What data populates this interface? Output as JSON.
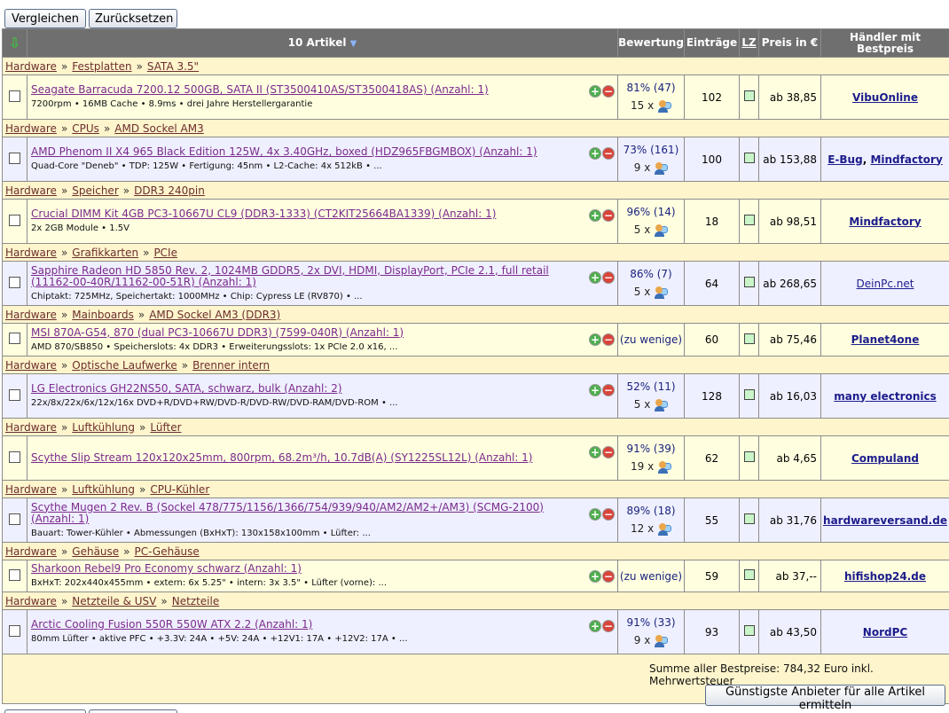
{
  "top_buttons": {
    "compare": "Vergleichen",
    "reset": "Zurücksetzen"
  },
  "header": {
    "sort_icon": "green-down-arrow-icon",
    "articles": "10 Artikel",
    "rating": "Bewertung",
    "entries": "Einträge",
    "lz": "LZ",
    "price": "Preis in €",
    "seller": "Händler mit Bestpreis"
  },
  "sections": [
    {
      "path": [
        "Hardware",
        "Festplatten",
        "SATA 3.5\""
      ],
      "item": {
        "name": "Seagate Barracuda 7200.12 500GB, SATA II (ST3500410AS/ST3500418AS) (Anzahl: 1)",
        "desc": "7200rpm • 16MB Cache • 8.9ms • drei Jahre Herstellergarantie",
        "rating": "81% (47)",
        "reviews": "15 x",
        "entries": "102",
        "price": "ab 38,85",
        "sellers": [
          "VibuOnline"
        ],
        "seller_style": "bold"
      }
    },
    {
      "path": [
        "Hardware",
        "CPUs",
        "AMD Sockel AM3"
      ],
      "item": {
        "name": "AMD Phenom II X4 965 Black Edition 125W, 4x 3.40GHz, boxed (HDZ965FBGMBOX) (Anzahl: 1)",
        "desc": "Quad-Core \"Deneb\" • TDP: 125W • Fertigung: 45nm • L2-Cache: 4x 512kB • ...",
        "rating": "73% (161)",
        "reviews": "9 x",
        "entries": "100",
        "price": "ab 153,88",
        "sellers": [
          "E-Bug",
          "Mindfactory"
        ],
        "seller_style": "bold"
      }
    },
    {
      "path": [
        "Hardware",
        "Speicher",
        "DDR3 240pin"
      ],
      "item": {
        "name": "Crucial DIMM Kit 4GB PC3-10667U CL9 (DDR3-1333) (CT2KIT25664BA1339) (Anzahl: 1)",
        "desc": "2x 2GB Module • 1.5V",
        "rating": "96% (14)",
        "reviews": "5 x",
        "entries": "18",
        "price": "ab 98,51",
        "sellers": [
          "Mindfactory"
        ],
        "seller_style": "bold"
      }
    },
    {
      "path": [
        "Hardware",
        "Grafikkarten",
        "PCIe"
      ],
      "item": {
        "name": "Sapphire Radeon HD 5850 Rev. 2, 1024MB GDDR5, 2x DVI, HDMI, DisplayPort, PCIe 2.1, full retail (11162-00-40R/11162-00-51R) (Anzahl: 1)",
        "desc": "Chiptakt: 725MHz, Speichertakt: 1000MHz • Chip: Cypress LE (RV870) • ...",
        "rating": "86% (7)",
        "reviews": "5 x",
        "entries": "64",
        "price": "ab 268,65",
        "sellers": [
          "DeinPc.net"
        ],
        "seller_style": "plain"
      }
    },
    {
      "path": [
        "Hardware",
        "Mainboards",
        "AMD Sockel AM3 (DDR3)"
      ],
      "item": {
        "name": "MSI 870A-G54, 870 (dual PC3-10667U DDR3) (7599-040R) (Anzahl: 1)",
        "desc": "AMD 870/SB850 • Speicherslots: 4x DDR3 • Erweiterungsslots: 1x PCIe 2.0 x16, ...",
        "rating": "(zu wenige)",
        "reviews": "",
        "entries": "60",
        "price": "ab 75,46",
        "sellers": [
          "Planet4one"
        ],
        "seller_style": "bold"
      }
    },
    {
      "path": [
        "Hardware",
        "Optische Laufwerke",
        "Brenner intern"
      ],
      "item": {
        "name": "LG Electronics GH22NS50, SATA, schwarz, bulk (Anzahl: 2)",
        "desc": "22x/8x/22x/6x/12x/16x DVD+R/DVD+RW/DVD-R/DVD-RW/DVD-RAM/DVD-ROM • ...",
        "rating": "52% (11)",
        "reviews": "5 x",
        "entries": "128",
        "price": "ab 16,03",
        "sellers": [
          "many electronics"
        ],
        "seller_style": "bold"
      }
    },
    {
      "path": [
        "Hardware",
        "Luftkühlung",
        "Lüfter"
      ],
      "item": {
        "name": "Scythe Slip Stream 120x120x25mm, 800rpm, 68.2m³/h, 10.7dB(A) (SY1225SL12L) (Anzahl: 1)",
        "desc": "",
        "rating": "91% (39)",
        "reviews": "19 x",
        "entries": "62",
        "price": "ab 4,65",
        "sellers": [
          "Compuland"
        ],
        "seller_style": "bold"
      }
    },
    {
      "path": [
        "Hardware",
        "Luftkühlung",
        "CPU-Kühler"
      ],
      "item": {
        "name": "Scythe Mugen 2 Rev. B (Sockel 478/775/1156/1366/754/939/940/AM2/AM2+/AM3) (SCMG-2100) (Anzahl: 1)",
        "desc": "Bauart: Tower-Kühler • Abmessungen (BxHxT): 130x158x100mm • Lüfter: ...",
        "rating": "89% (18)",
        "reviews": "12 x",
        "entries": "55",
        "price": "ab 31,76",
        "sellers": [
          "hardwareversand.de"
        ],
        "seller_style": "bold"
      }
    },
    {
      "path": [
        "Hardware",
        "Gehäuse",
        "PC-Gehäuse"
      ],
      "item": {
        "name": "Sharkoon Rebel9 Pro Economy schwarz (Anzahl: 1)",
        "desc": "BxHxT: 202x440x455mm • extern: 6x 5.25\" • intern: 3x 3.5\" • Lüfter (vorne): ...",
        "rating": "(zu wenige)",
        "reviews": "",
        "entries": "59",
        "price": "ab 37,--",
        "sellers": [
          "hifishop24.de"
        ],
        "seller_style": "bold"
      }
    },
    {
      "path": [
        "Hardware",
        "Netzteile & USV",
        "Netzteile"
      ],
      "item": {
        "name": "Arctic Cooling Fusion 550R 550W ATX 2.2 (Anzahl: 1)",
        "desc": "80mm Lüfter • aktive PFC • +3.3V: 24A • +5V: 24A • +12V1: 17A • +12V2: 17A • ...",
        "rating": "91% (33)",
        "reviews": "9 x",
        "entries": "93",
        "price": "ab 43,50",
        "sellers": [
          "NordPC"
        ],
        "seller_style": "bold"
      }
    }
  ],
  "footer": {
    "sum": "Summe aller Bestpreise: 784,32 Euro inkl. Mehrwertsteuer",
    "cheapest_button": "Günstigste Anbieter für alle Artikel ermitteln"
  },
  "icons": {
    "add": "plus-circle-icon",
    "remove": "minus-circle-icon",
    "reviews": "user-review-icon"
  }
}
